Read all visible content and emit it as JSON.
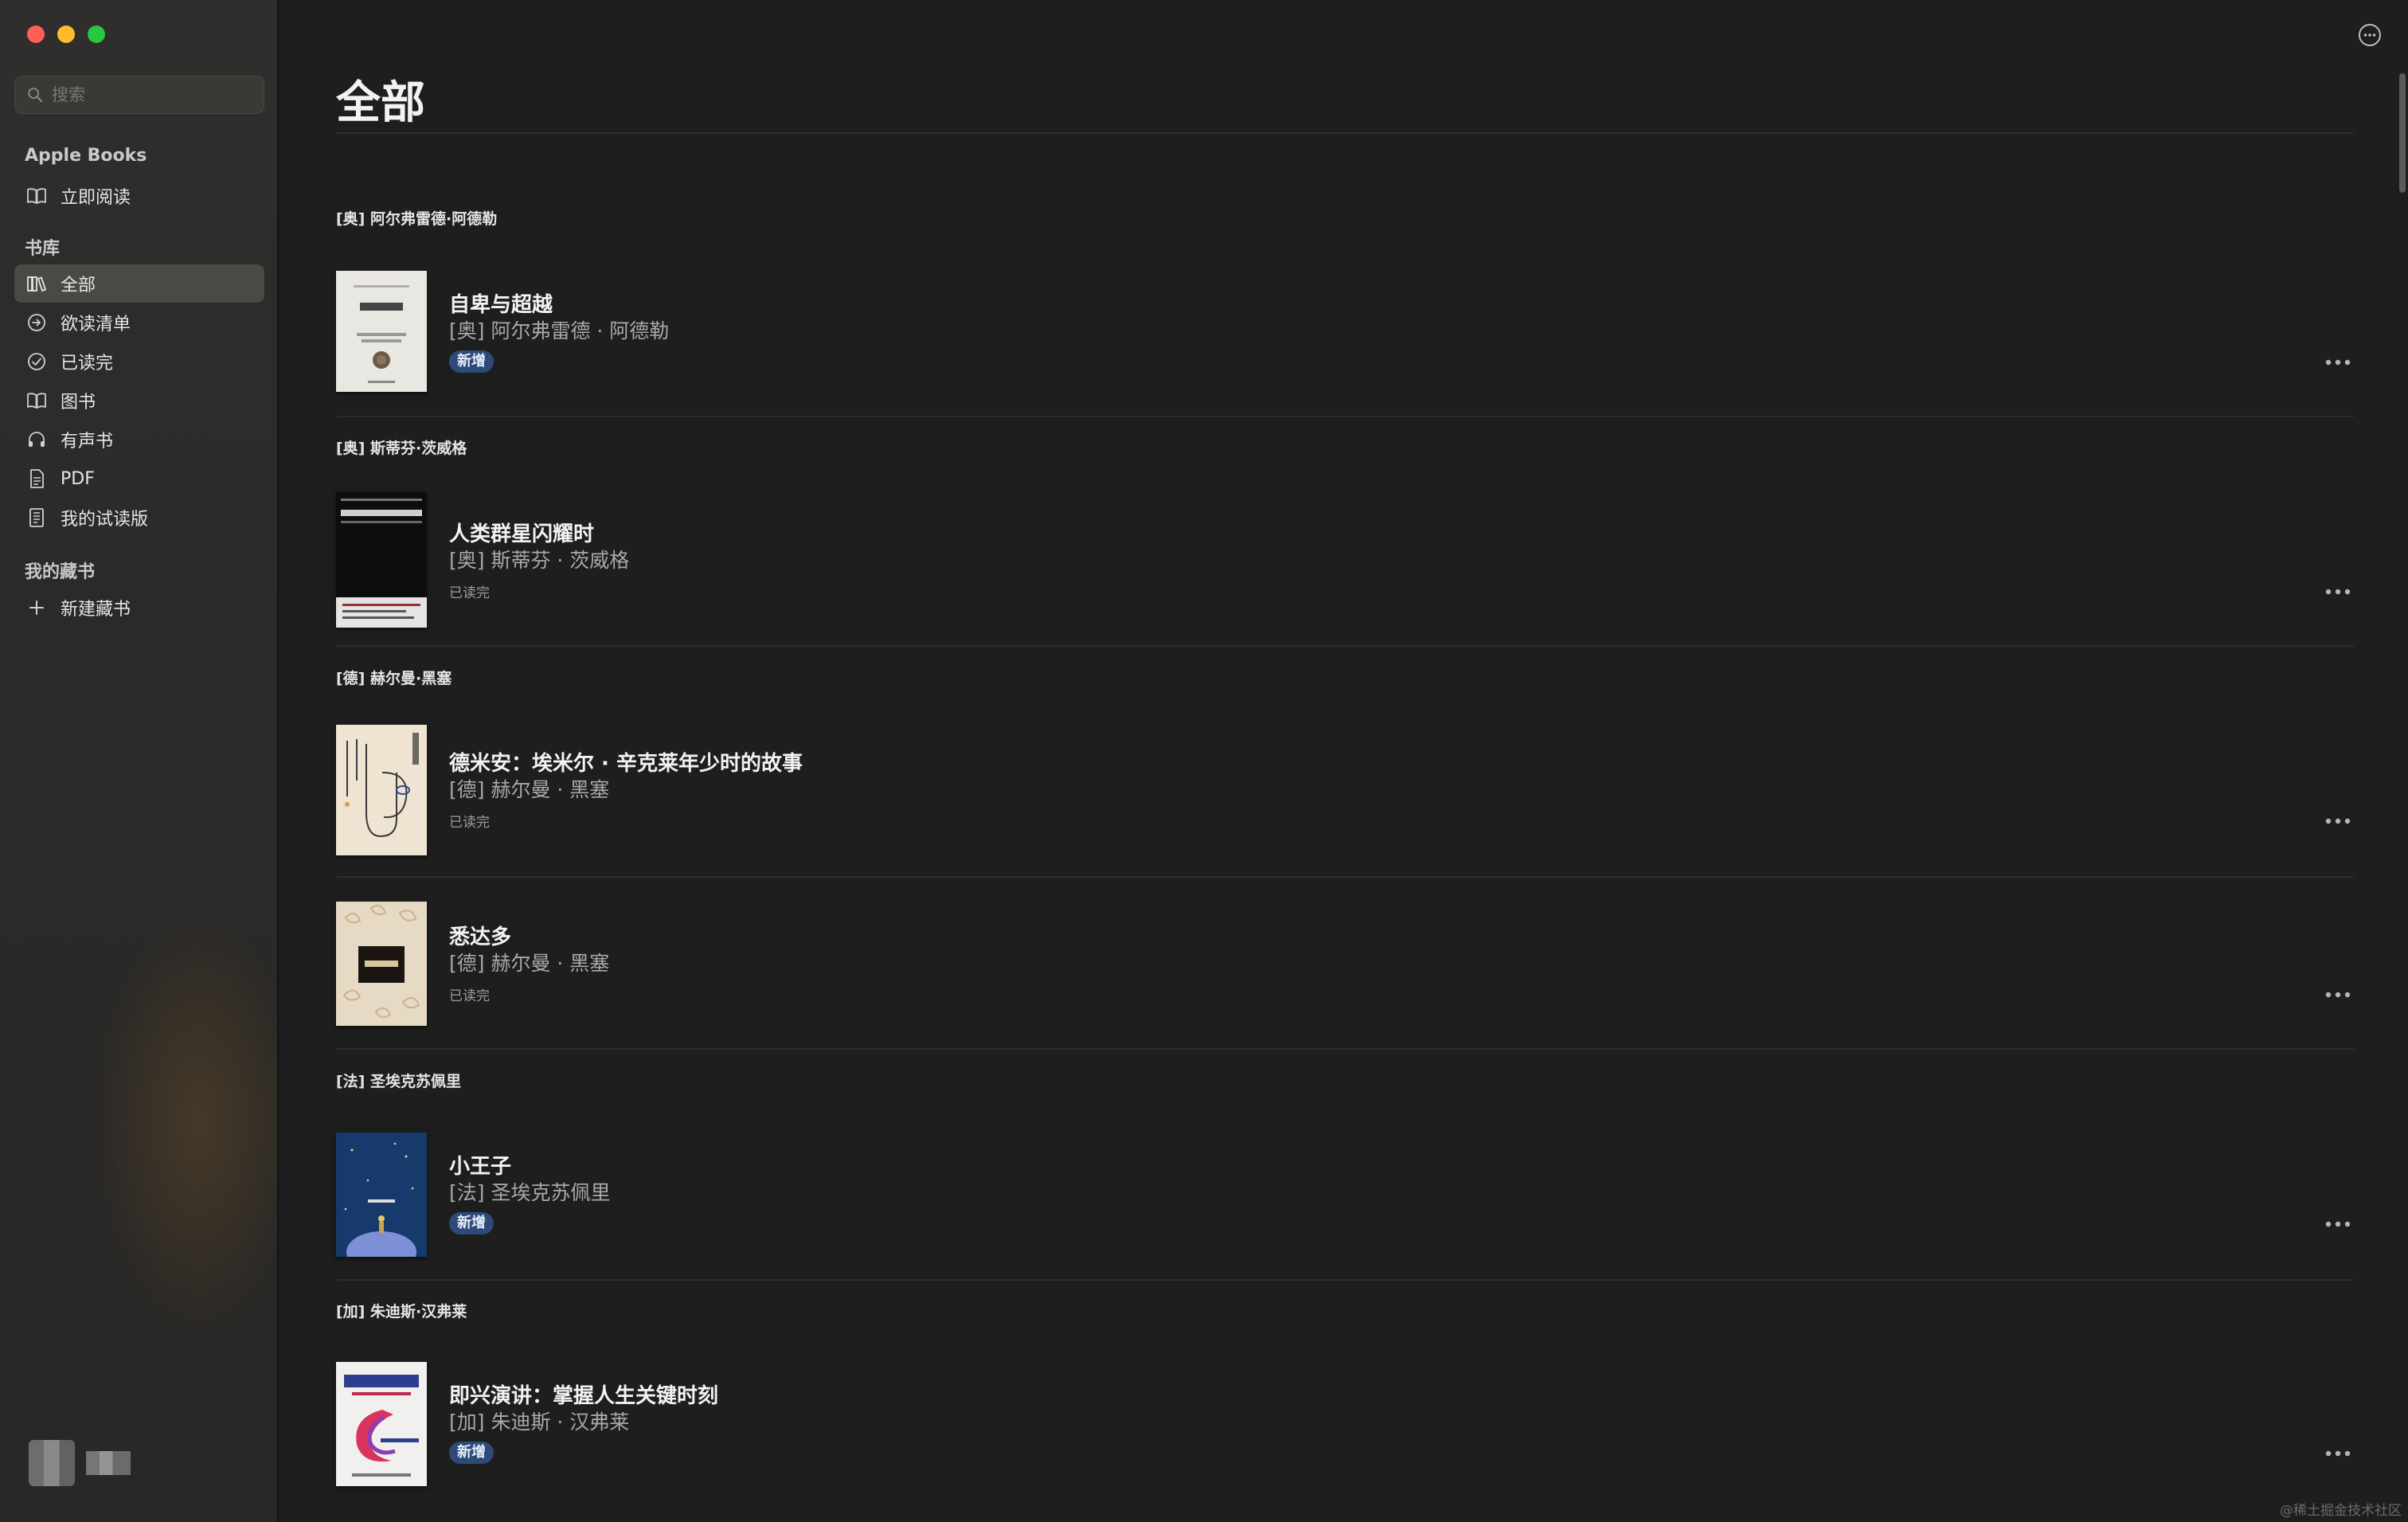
{
  "sidebar": {
    "search_placeholder": "搜索",
    "sections": {
      "apple_books": "Apple Books",
      "library": "书库",
      "collections": "我的藏书"
    },
    "items": [
      {
        "label": "立即阅读",
        "icon": "open-book-icon"
      },
      {
        "label": "全部",
        "icon": "library-icon",
        "active": true
      },
      {
        "label": "欲读清单",
        "icon": "arrow-circle-icon"
      },
      {
        "label": "已读完",
        "icon": "check-circle-icon"
      },
      {
        "label": "图书",
        "icon": "book-icon"
      },
      {
        "label": "有声书",
        "icon": "headphones-icon"
      },
      {
        "label": "PDF",
        "icon": "document-icon"
      },
      {
        "label": "我的试读版",
        "icon": "sample-icon"
      },
      {
        "label": "新建藏书",
        "icon": "plus-icon"
      }
    ]
  },
  "main": {
    "title": "全部",
    "groups": [
      {
        "author_heading": "[奥] 阿尔弗雷德·阿德勒"
      },
      {
        "author_heading": "[奥] 斯蒂芬·茨威格"
      },
      {
        "author_heading": "[德] 赫尔曼·黑塞"
      },
      {
        "author_heading": "[法] 圣埃克苏佩里"
      },
      {
        "author_heading": "[加] 朱迪斯·汉弗莱"
      }
    ],
    "books": [
      {
        "title": "自卑与超越",
        "author": "[奥] 阿尔弗雷德 · 阿德勒",
        "badge": "新增"
      },
      {
        "title": "人类群星闪耀时",
        "author": "[奥] 斯蒂芬 · 茨威格",
        "status": "已读完"
      },
      {
        "title": "德米安：埃米尔 · 辛克莱年少时的故事",
        "author": "[德] 赫尔曼 · 黑塞",
        "status": "已读完"
      },
      {
        "title": "悉达多",
        "author": "[德] 赫尔曼 · 黑塞",
        "status": "已读完"
      },
      {
        "title": "小王子",
        "author": "[法] 圣埃克苏佩里",
        "badge": "新增"
      },
      {
        "title": "即兴演讲：掌握人生关键时刻",
        "author": "[加] 朱迪斯 · 汉弗莱",
        "badge": "新增"
      }
    ]
  },
  "watermark": "@稀土掘金技术社区",
  "colors": {
    "window_bg": "#1e1e1e",
    "sidebar_bg": "#2d2c2a",
    "badge_bg": "#2d4a78",
    "close": "#fe5f57",
    "minimize": "#febc2e",
    "maximize": "#28c840"
  }
}
